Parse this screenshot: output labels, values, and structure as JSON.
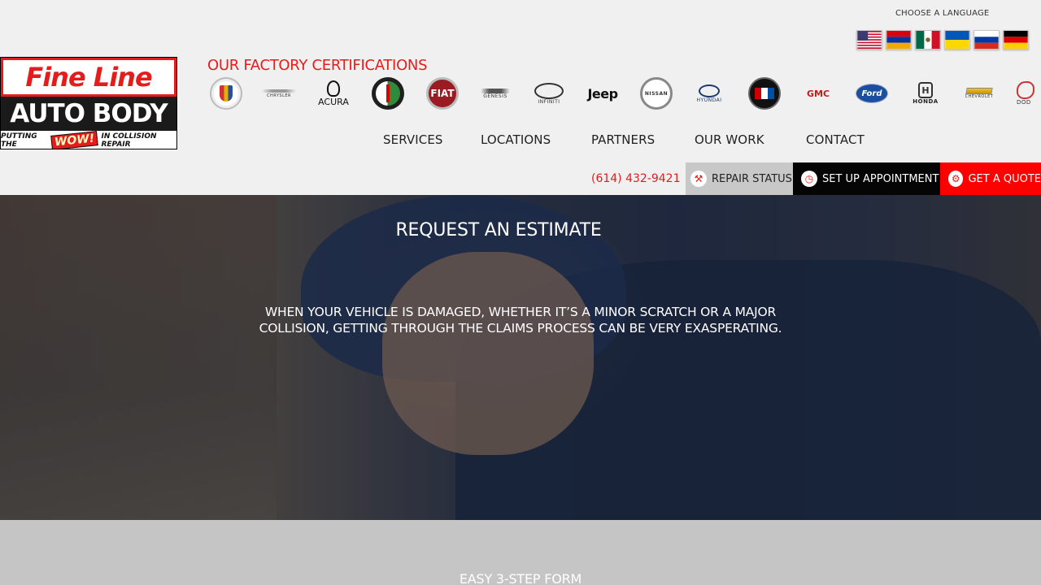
{
  "language": {
    "label": "CHOOSE A LANGUAGE",
    "flags": [
      "us-flag-icon",
      "armenia-flag-icon",
      "mexico-flag-icon",
      "ukraine-flag-icon",
      "russia-flag-icon",
      "germany-flag-icon"
    ]
  },
  "logo": {
    "line1": "Fine Line",
    "line2": "AUTO BODY",
    "tagline_pre": "PUTTING THE",
    "tagline_wow": "WOW!",
    "tagline_post": "IN COLLISION REPAIR"
  },
  "certifications": {
    "title": "OUR FACTORY CERTIFICATIONS",
    "brands": [
      {
        "name": "cadillac",
        "label": ""
      },
      {
        "name": "chrysler",
        "label": "CHRYSLER"
      },
      {
        "name": "acura",
        "label": "ACURA"
      },
      {
        "name": "alfa-romeo",
        "label": ""
      },
      {
        "name": "fiat",
        "label": "FIAT"
      },
      {
        "name": "genesis",
        "label": "GENESIS"
      },
      {
        "name": "infiniti",
        "label": "INFINITI"
      },
      {
        "name": "jeep",
        "label": "Jeep"
      },
      {
        "name": "nissan",
        "label": "NISSAN"
      },
      {
        "name": "hyundai",
        "label": "HYUNDAI"
      },
      {
        "name": "buick",
        "label": ""
      },
      {
        "name": "gmc",
        "label": "GMC"
      },
      {
        "name": "ford",
        "label": "Ford"
      },
      {
        "name": "honda",
        "label": "HONDA"
      },
      {
        "name": "chevrolet",
        "label": "CHEVROLET"
      },
      {
        "name": "dodge",
        "label": "DOD"
      }
    ]
  },
  "nav": {
    "items": [
      "SERVICES",
      "LOCATIONS",
      "PARTNERS",
      "OUR WORK",
      "CONTACT"
    ]
  },
  "contact": {
    "phone": "(614) 432-9421",
    "repair_status": "REPAIR STATUS",
    "appointment": "SET UP APPOINTMENT",
    "quote": "GET A QUOTE"
  },
  "colors": {
    "brand_red": "#e51c1c",
    "cta_quote": "#ff0000",
    "cta_appt": "#050505",
    "cta_repair": "#c8c8c8"
  },
  "hero": {
    "title": "REQUEST AN ESTIMATE",
    "text": "WHEN YOUR VEHICLE IS DAMAGED, WHETHER IT’S A MINOR SCRATCH OR A MAJOR COLLISION, GETTING THROUGH THE CLAIMS PROCESS CAN BE VERY EXASPERATING."
  },
  "form": {
    "title": "EASY 3-STEP FORM"
  }
}
